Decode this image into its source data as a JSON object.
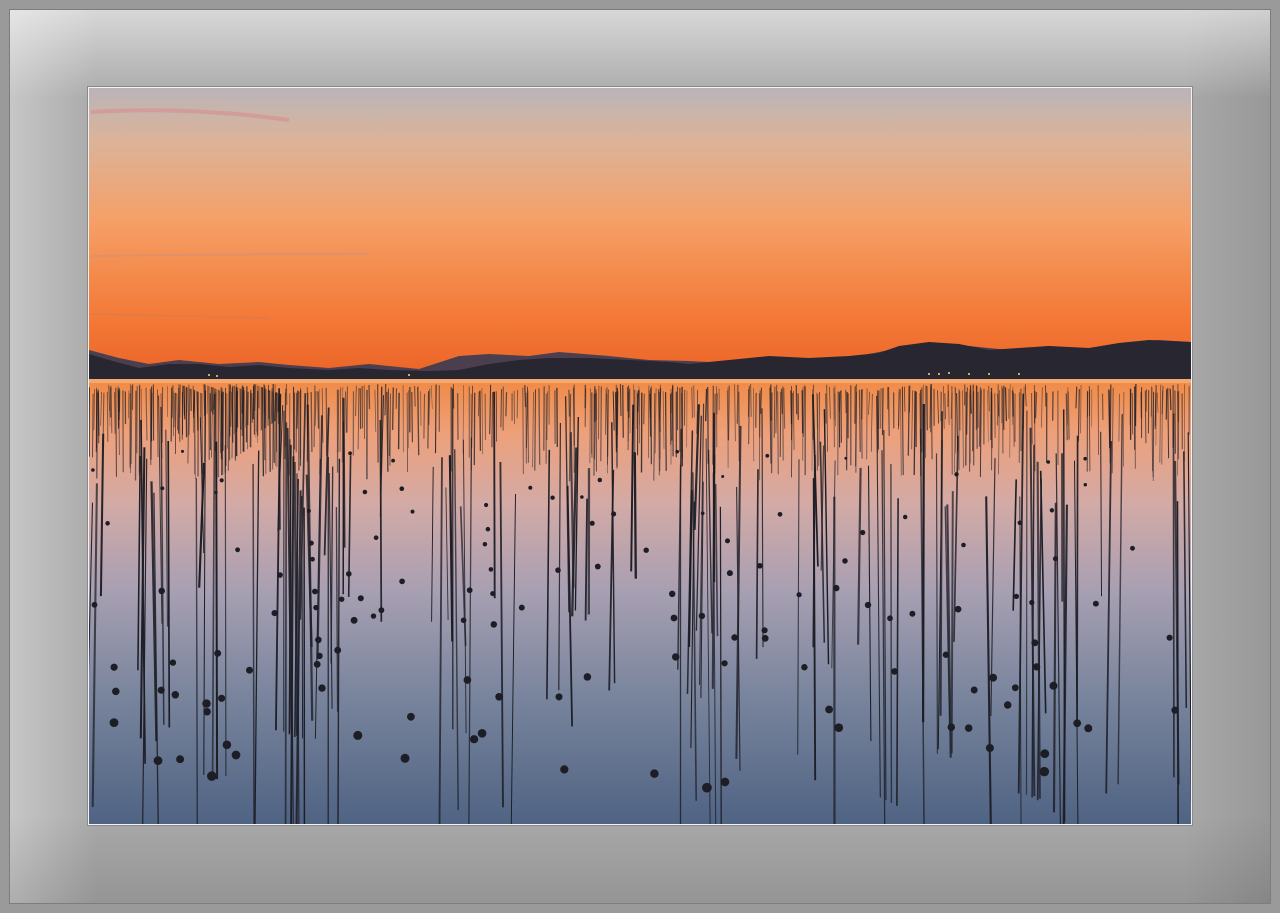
{
  "image": {
    "alt_subject": "sunset-over-calm-water-with-reed-poles",
    "colors": {
      "sky_top": "#b8aeb1",
      "sky_mid": "#f3a46d",
      "sky_low": "#f26d2d",
      "horizon": "#e85f25",
      "mountains": "#2b2a33",
      "distant_hills": "#4a4050",
      "water_top": "#f1803f",
      "water_mid": "#c7a2a4",
      "water_low": "#5d6f8c",
      "water_bottom": "#4b5f7f",
      "poles": "#1b1c24",
      "mat": "#a9a9a9",
      "inner_border": "#f2f2f2"
    }
  }
}
